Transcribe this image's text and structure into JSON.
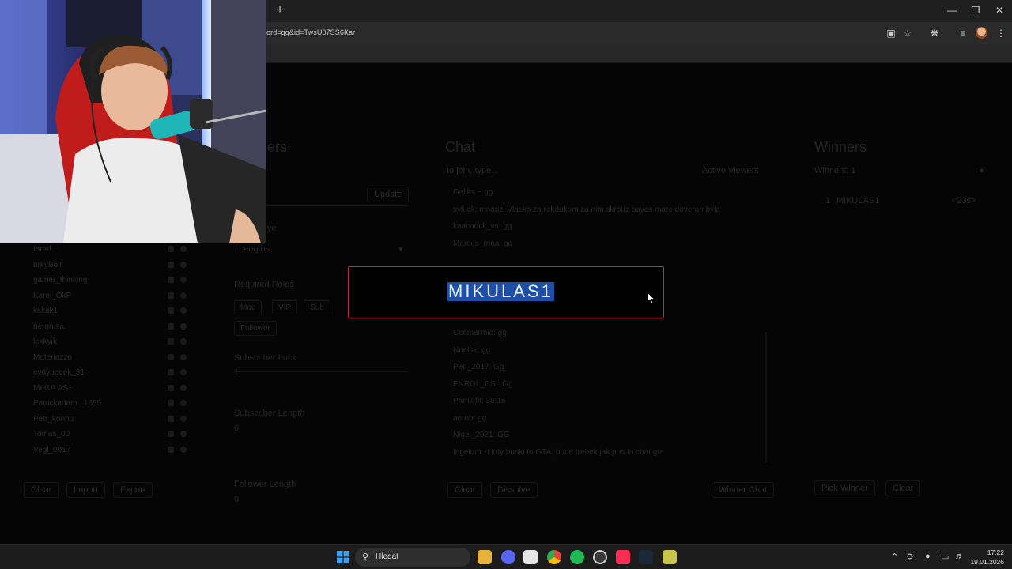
{
  "browser": {
    "new_tab": "+",
    "url": "ord=gg&id=TwsU07SS6Kar",
    "window_controls": [
      "minimize-icon",
      "restore-icon",
      "close-icon"
    ],
    "toolbar_icons": [
      "camera-off-icon",
      "star-icon",
      "extensions-icon",
      "media-icon",
      "profile-icon",
      "menu-icon"
    ]
  },
  "page": {
    "viewers_heading": "ers",
    "chat_heading": "Chat",
    "winners_heading": "Winners",
    "chat_input_placeholder": "to join, type...",
    "active_viewers_label": "Active Viewers",
    "winners_count_label": "Winners: 1",
    "update_button": "Update",
    "sub_label": "ye",
    "dropdown_value": "Lengths",
    "required_roles_label": "Required Roles",
    "roles": [
      "Mod",
      "VIP",
      "Sub",
      "Follower"
    ],
    "subscriber_luck_label": "Subscriber Luck",
    "subscriber_luck_value": "1",
    "subscriber_length_label": "Subscriber Length",
    "subscriber_length_value": "0",
    "follower_length_label": "Follower Length",
    "follower_length_value": "0",
    "viewers": [
      "tarad..",
      "brkyBolt",
      "gamer_thinking",
      "Karel_OkP",
      "kskak1",
      "bergn.sa.",
      "lekkyik",
      "Materiazzo",
      "evdypeeek_31",
      "MIKULAS1",
      "Patrickadam...1655",
      "Petr_konnu",
      "Tomas_00",
      "Vegl_0017"
    ],
    "viewer_buttons": [
      "Clear",
      "Import",
      "Export"
    ],
    "chat_messages_top": [
      "Galiks ~ gg",
      "xyluck: mnauzi Vlasko za rekdukom za nim skrouz bayes mare doveran byla",
      "kaacoock_vs: gg",
      "Marcus_rnna: gg"
    ],
    "chat_messages_bottom": [
      "Ccamermio: gg",
      "Nnelsk: gg",
      "Ped_2017: Gg",
      "ENROL_CSI: Gg",
      "Patrik fit: 30:15",
      "anrnb: gg",
      "Nigel_2021: GG",
      "Ingelum zi kdy bunki to GTA, bude trebek jak pos to chat gta"
    ],
    "chat_buttons": [
      "Clear",
      "Dissolve"
    ],
    "winner_chat_button": "Winner Chat",
    "winners_row": {
      "rank": "1",
      "name": "MIKULAS1",
      "time": "<23s>"
    },
    "winner_buttons": [
      "Pick Winner",
      "Clear"
    ]
  },
  "modal": {
    "winner_name": "MIKULAS1",
    "border_color": "#d21f5e",
    "highlight_color": "#1d4fa8"
  },
  "taskbar": {
    "search_placeholder": "Hledat",
    "apps": [
      "file-explorer-icon",
      "discord-icon",
      "snipping-icon",
      "chrome-icon",
      "spotify-icon",
      "obs-icon",
      "tiktok-icon",
      "steam-icon",
      "app-icon"
    ],
    "time": "17:22",
    "date": "19.01.2026"
  }
}
